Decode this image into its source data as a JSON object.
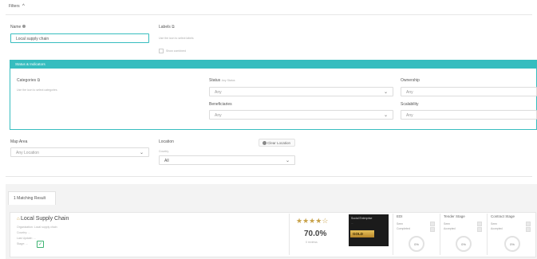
{
  "filters": {
    "title": "Filters",
    "toggle_icon": "chevron-up"
  },
  "name": {
    "label": "Name",
    "value": "Local supply chain"
  },
  "labels": {
    "label": "Labels",
    "hint": "Use the icon to select labels",
    "show_combined": "Show combined"
  },
  "status_section": {
    "header": "Status & Indicators",
    "categories_label": "Categories",
    "categories_hint": "Use the icon to select categories",
    "status_label": "Status",
    "status_sub": "Any Status",
    "status_value": "Any",
    "beneficiaries_label": "Beneficiaries",
    "beneficiaries_value": "Any",
    "ownership_label": "Ownership",
    "ownership_value": "Any",
    "scalability_label": "Scalability",
    "scalability_value": "Any"
  },
  "map_area": {
    "label": "Map Area",
    "value": "Any Location"
  },
  "location": {
    "label": "Location",
    "clear_label": "Clear Location",
    "country_label": "Country",
    "country_value": "All"
  },
  "results": {
    "tab_label": "1 Matching Result"
  },
  "result": {
    "title": "Local Supply Chain",
    "meta_lines": [
      "Organization: Local supply chain",
      "Country: ...",
      "Last Update: ...",
      "Stage: ..."
    ],
    "rating": {
      "stars_filled": 3.5,
      "stars_total": 5
    },
    "score": "70.0%",
    "score_sub": "0 reviews",
    "badge": {
      "line1": "Social Enterprise",
      "line2": "...",
      "tier": "GOLD"
    },
    "stages": [
      {
        "title": "EDI",
        "line1": "Seen",
        "line2": "Completed",
        "percent": "0%"
      },
      {
        "title": "Tender Stage",
        "line1": "Seen",
        "line2": "Accepted",
        "percent": "0%"
      },
      {
        "title": "Contract Stage",
        "line1": "Seen",
        "line2": "Accepted",
        "percent": "0%"
      }
    ]
  },
  "colors": {
    "accent": "#36bdbf",
    "star": "#c8a24a",
    "check": "#3cb371"
  }
}
